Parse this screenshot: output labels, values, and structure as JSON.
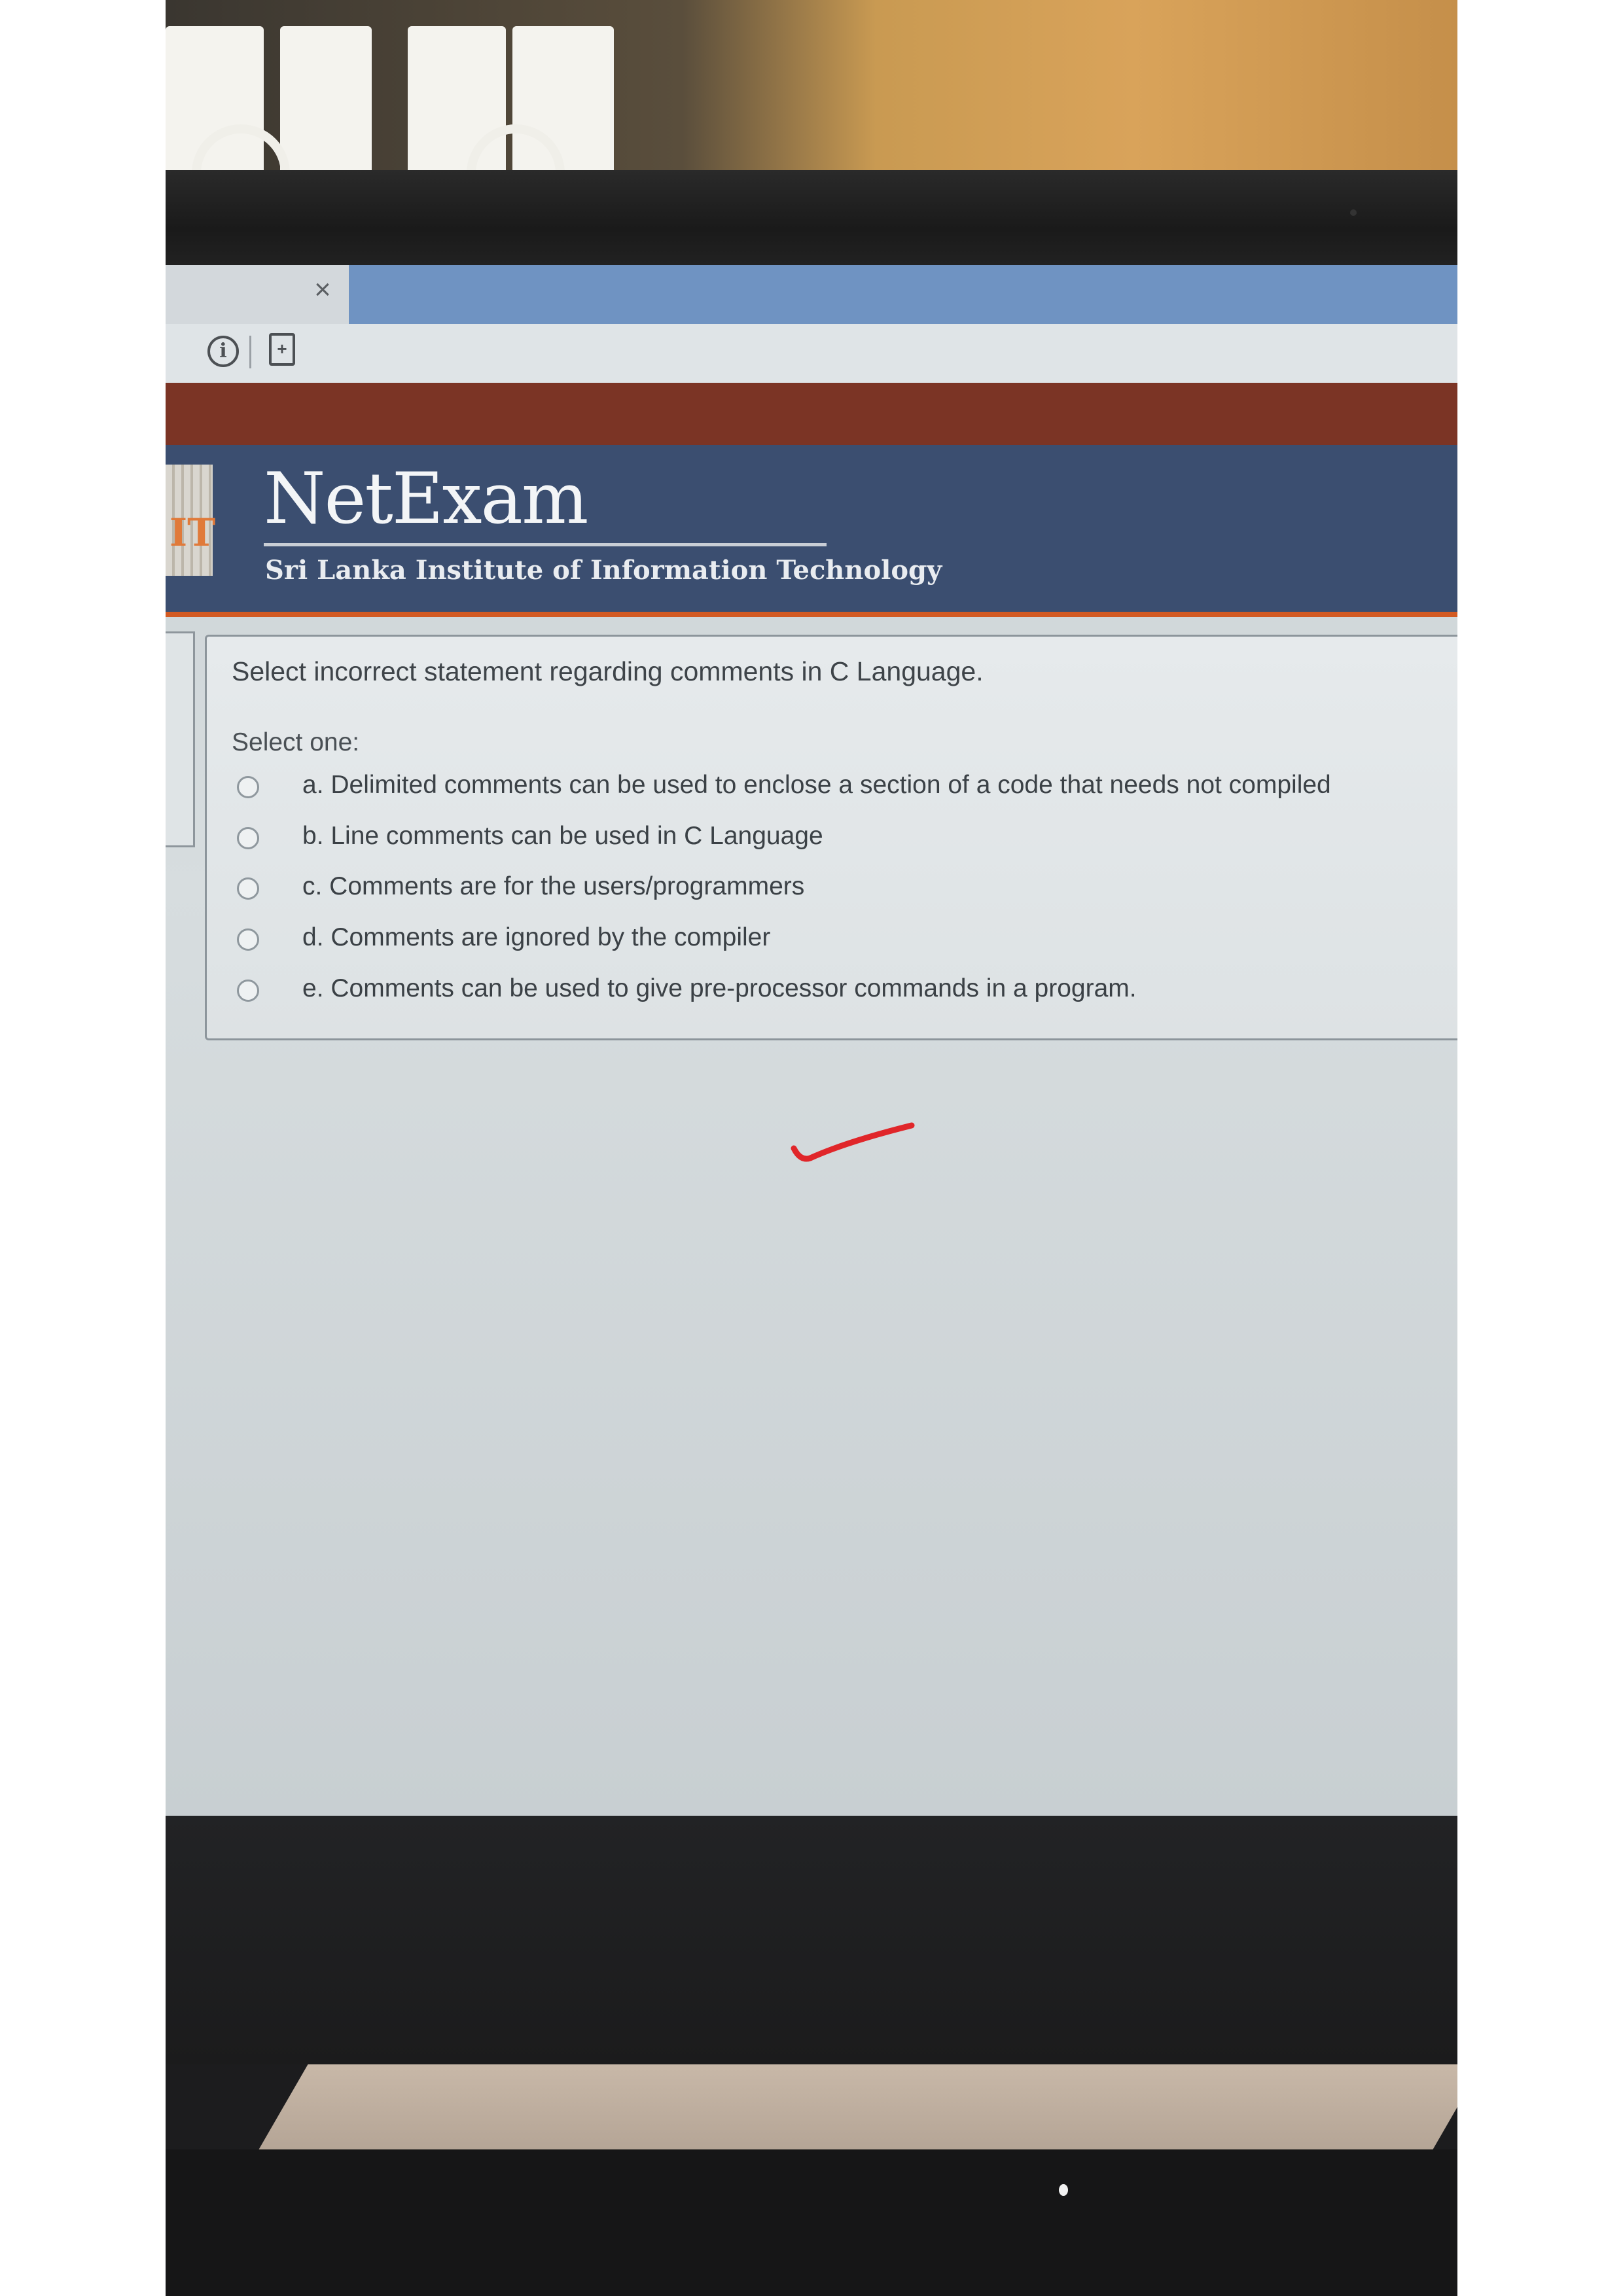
{
  "browser": {
    "tab_close_glyph": "×",
    "info_glyph": "i",
    "page_glyph": "+"
  },
  "header": {
    "logo_letters": "IT",
    "title": "NetExam",
    "subtitle": "Sri Lanka Institute of Information Technology"
  },
  "question": {
    "text": "Select incorrect statement regarding comments in C Language.",
    "prompt": "Select one:",
    "options": [
      {
        "label": "a. Delimited comments can be used to enclose a section of a code that needs not compiled"
      },
      {
        "label": "b. Line comments can be used in C Language"
      },
      {
        "label": "c. Comments are for the users/programmers"
      },
      {
        "label": "d. Comments are ignored by the compiler"
      },
      {
        "label": "e. Comments can be used to give pre-processor commands in a program."
      }
    ]
  },
  "colors": {
    "header_bg": "#3b4e70",
    "header_accent": "#d35a22",
    "tick_mark": "#e0262a"
  }
}
